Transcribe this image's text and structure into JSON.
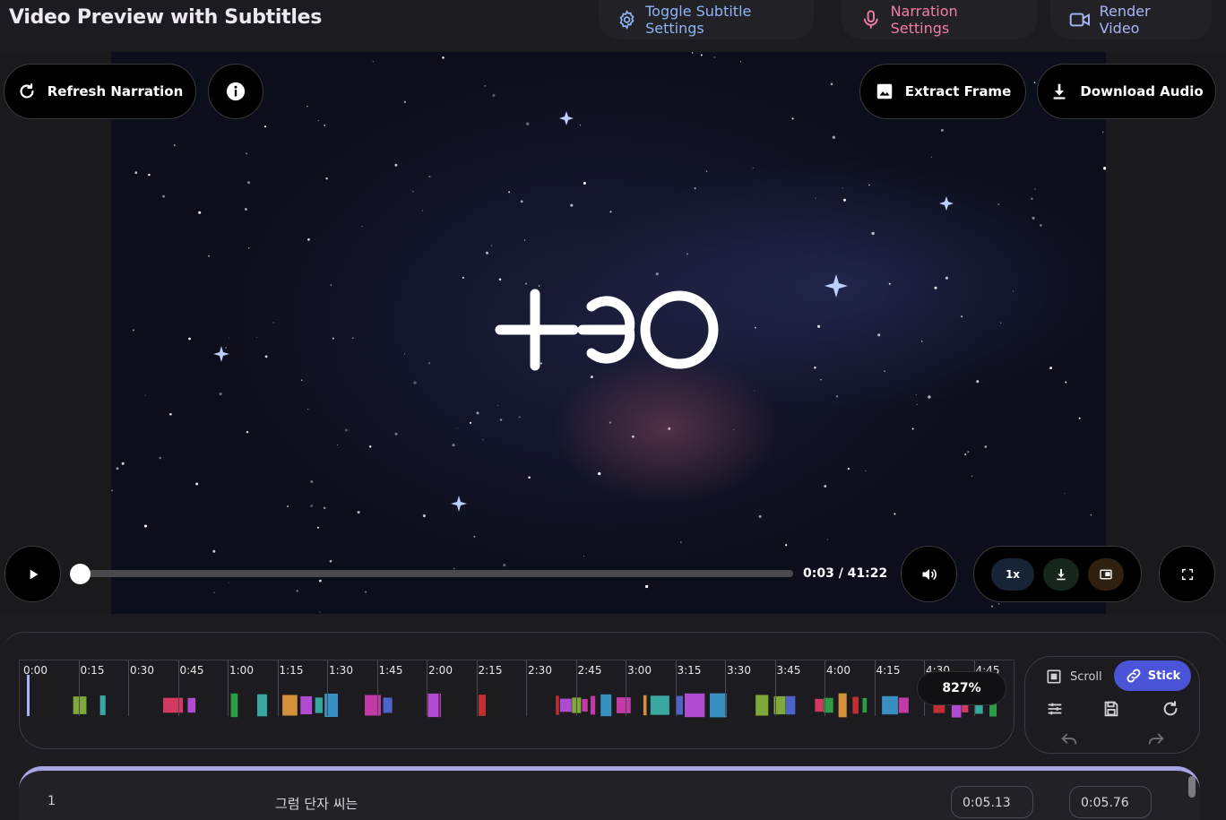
{
  "header": {
    "title": "Video Preview with Subtitles",
    "toggle_subtitle_label": "Toggle Subtitle Settings",
    "narration_settings_label": "Narration Settings",
    "render_video_label": "Render Video"
  },
  "video": {
    "refresh_narration_label": "Refresh Narration",
    "extract_frame_label": "Extract Frame",
    "download_audio_label": "Download Audio",
    "time_display": "0:03 / 41:22",
    "progress": 0.0012,
    "speed_label": "1x"
  },
  "timeline": {
    "tick_labels": [
      "0:00",
      "0:15",
      "0:30",
      "0:45",
      "1:00",
      "1:15",
      "1:30",
      "1:45",
      "2:00",
      "2:15",
      "2:30",
      "2:45",
      "3:00",
      "3:15",
      "3:30",
      "3:45",
      "4:00",
      "4:15",
      "4:30",
      "4:45"
    ],
    "zoom_label": "827%",
    "scroll_label": "Scroll",
    "stick_label": "Stick"
  },
  "subtitle_list": {
    "rows": [
      {
        "index": "1",
        "text": "그럼 단자 씨는",
        "start": "0:05.13",
        "end": "0:05.76"
      }
    ]
  },
  "colors": {
    "accent": "#4b54d6",
    "subtitle_blue": "#8fb4f5",
    "narration_pink": "#f07fa5",
    "render_lavender": "#a9b6f8"
  }
}
